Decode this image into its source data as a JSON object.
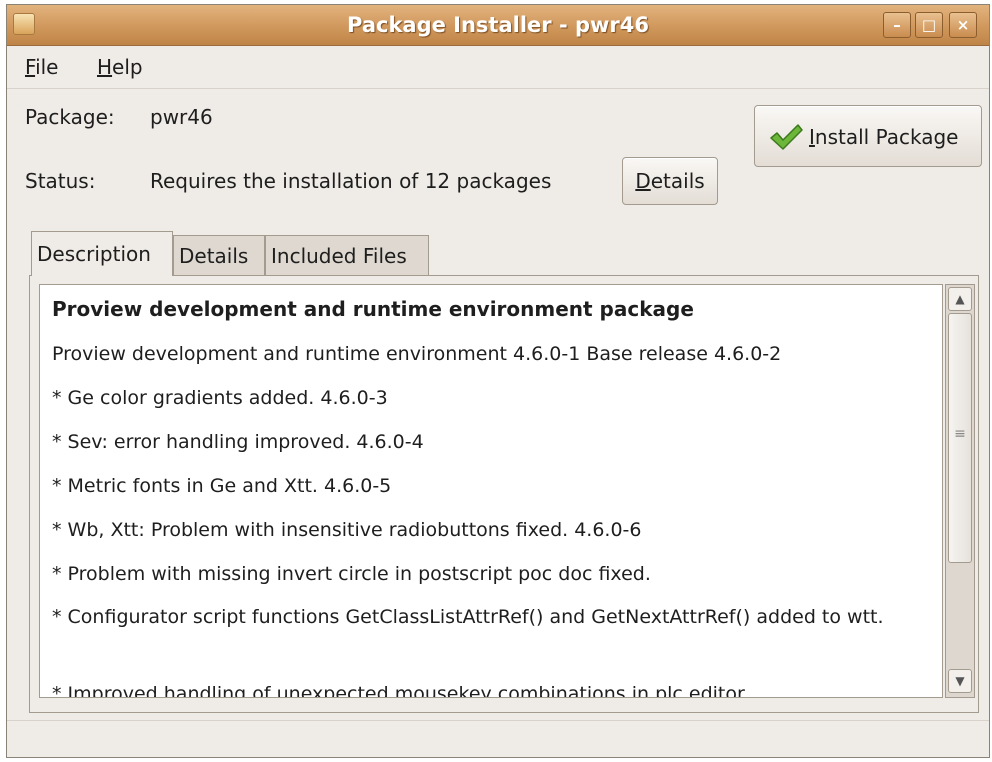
{
  "window": {
    "title": "Package Installer - pwr46",
    "minimize_glyph": "–",
    "maximize_glyph": "□",
    "close_glyph": "×"
  },
  "menu": {
    "file_mnemonic": "F",
    "file_rest": "ile",
    "help_mnemonic": "H",
    "help_rest": "elp"
  },
  "package": {
    "label": "Package:",
    "value": "pwr46"
  },
  "status": {
    "label": "Status:",
    "value": "Requires the installation of 12 packages"
  },
  "buttons": {
    "details_mnemonic": "D",
    "details_rest": "etails",
    "install_mnemonic": "I",
    "install_rest": "nstall Package"
  },
  "tabs": {
    "description": "Description",
    "details": "Details",
    "included_files": "Included Files"
  },
  "description": {
    "heading": "Proview development and runtime environment package",
    "lines": [
      "Proview development and runtime environment 4.6.0-1 Base release 4.6.0-2",
      "* Ge color gradients added. 4.6.0-3",
      "* Sev: error handling improved. 4.6.0-4",
      "* Metric fonts in Ge and Xtt. 4.6.0-5",
      "* Wb, Xtt: Problem with insensitive radiobuttons fixed. 4.6.0-6",
      "* Problem with missing invert circle in postscript poc doc fixed.",
      "* Configurator script functions GetClassListAttrRef() and GetNextAttrRef() added to wtt.",
      "* Improved handling of unexpected mousekey combinations in plc editor."
    ]
  },
  "scrollbar": {
    "up_glyph": "▲",
    "down_glyph": "▼",
    "grip_glyph": "≡"
  },
  "colors": {
    "titlebar": "#d29a5f",
    "window_bg": "#efebe7",
    "check_green": "#5aa02c"
  }
}
